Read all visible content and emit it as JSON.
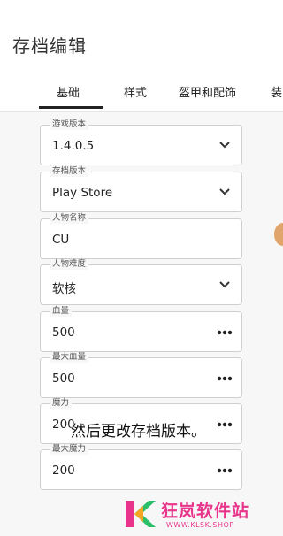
{
  "page": {
    "title": "存档编辑"
  },
  "tabs": [
    {
      "label": "基础",
      "active": true
    },
    {
      "label": "样式",
      "active": false
    },
    {
      "label": "盔甲和配饰",
      "active": false
    },
    {
      "label": "装",
      "active": false
    }
  ],
  "fields": [
    {
      "label": "游戏版本",
      "value": "1.4.0.5",
      "control": "dropdown",
      "icon": "chevron-down-icon"
    },
    {
      "label": "存档版本",
      "value": "Play Store",
      "control": "dropdown",
      "icon": "chevron-down-icon"
    },
    {
      "label": "人物名称",
      "value": "CU",
      "control": "text"
    },
    {
      "label": "人物难度",
      "value": "软核",
      "control": "dropdown",
      "icon": "chevron-down-icon"
    },
    {
      "label": "血量",
      "value": "500",
      "control": "number",
      "icon": "more-dots-icon"
    },
    {
      "label": "最大血量",
      "value": "500",
      "control": "number",
      "icon": "more-dots-icon"
    },
    {
      "label": "魔力",
      "value": "200",
      "control": "number",
      "icon": "more-dots-icon"
    },
    {
      "label": "最大魔力",
      "value": "200",
      "control": "number",
      "icon": "more-dots-icon"
    }
  ],
  "overlay": {
    "subtitle": "然后更改存档版本。"
  },
  "watermark": {
    "name": "狂岚软件站",
    "url": "WWW.KLSK.SHOP",
    "logo_letter": "K"
  },
  "colors": {
    "accent": "#e8348a",
    "tab_indicator": "#222222",
    "field_border": "#cfcfcf"
  }
}
